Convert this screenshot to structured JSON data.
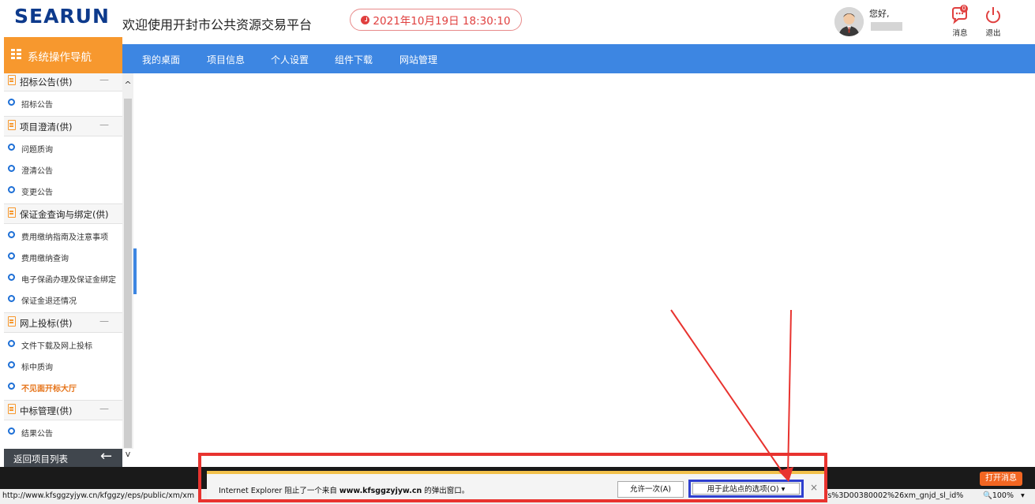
{
  "header": {
    "logo": "SEARUN",
    "site_title": "欢迎使用开封市公共资源交易平台",
    "datetime": "2021年10月19日 18:30:10",
    "greeting": "您好,",
    "messages_label": "消息",
    "messages_badge": "0",
    "logout_label": "退出"
  },
  "sidebar_toggle": {
    "label": "系统操作导航"
  },
  "nav": {
    "items": [
      {
        "label": "我的桌面"
      },
      {
        "label": "项目信息"
      },
      {
        "label": "个人设置"
      },
      {
        "label": "组件下载"
      },
      {
        "label": "网站管理"
      }
    ]
  },
  "sidebar": {
    "groups": [
      {
        "label": "招标公告(供)",
        "collapse": "—",
        "items": [
          {
            "label": "招标公告"
          }
        ]
      },
      {
        "label": "项目澄清(供)",
        "collapse": "—",
        "items": [
          {
            "label": "问题质询"
          },
          {
            "label": "澄清公告"
          },
          {
            "label": "变更公告"
          }
        ]
      },
      {
        "label": "保证金查询与绑定(供)",
        "collapse": "",
        "items": [
          {
            "label": "费用缴纳指南及注意事项"
          },
          {
            "label": "费用缴纳查询"
          },
          {
            "label": "电子保函办理及保证金绑定"
          },
          {
            "label": "保证金退还情况"
          }
        ]
      },
      {
        "label": "网上投标(供)",
        "collapse": "—",
        "items": [
          {
            "label": "文件下载及网上投标"
          },
          {
            "label": "标中质询"
          },
          {
            "label": "不见面开标大厅",
            "active": true
          }
        ]
      },
      {
        "label": "中标管理(供)",
        "collapse": "—",
        "items": [
          {
            "label": "结果公告"
          }
        ]
      }
    ],
    "back_label": "返回项目列表"
  },
  "bottom": {
    "open_messages": "打开消息",
    "status_url": "http://www.kfsggzyjyw.cn/kfggzy/eps/public/xm/xm",
    "status_url_tail": "fs%3D00380002%26xm_gnjd_sl_id%",
    "zoom": "100%"
  },
  "popup_bar": {
    "text_prefix": "Internet Explorer 阻止了一个来自 ",
    "domain": "www.kfsggzyjyw.cn",
    "text_suffix": " 的弹出窗口。",
    "allow_once": "允许一次(A)",
    "options": "用于此站点的选项(O)",
    "close": "×"
  },
  "colors": {
    "nav_blue": "#3d86e2",
    "accent_orange": "#f7982e",
    "annotation_red": "#e8332f",
    "highlight_blue": "#2f3fcf"
  }
}
